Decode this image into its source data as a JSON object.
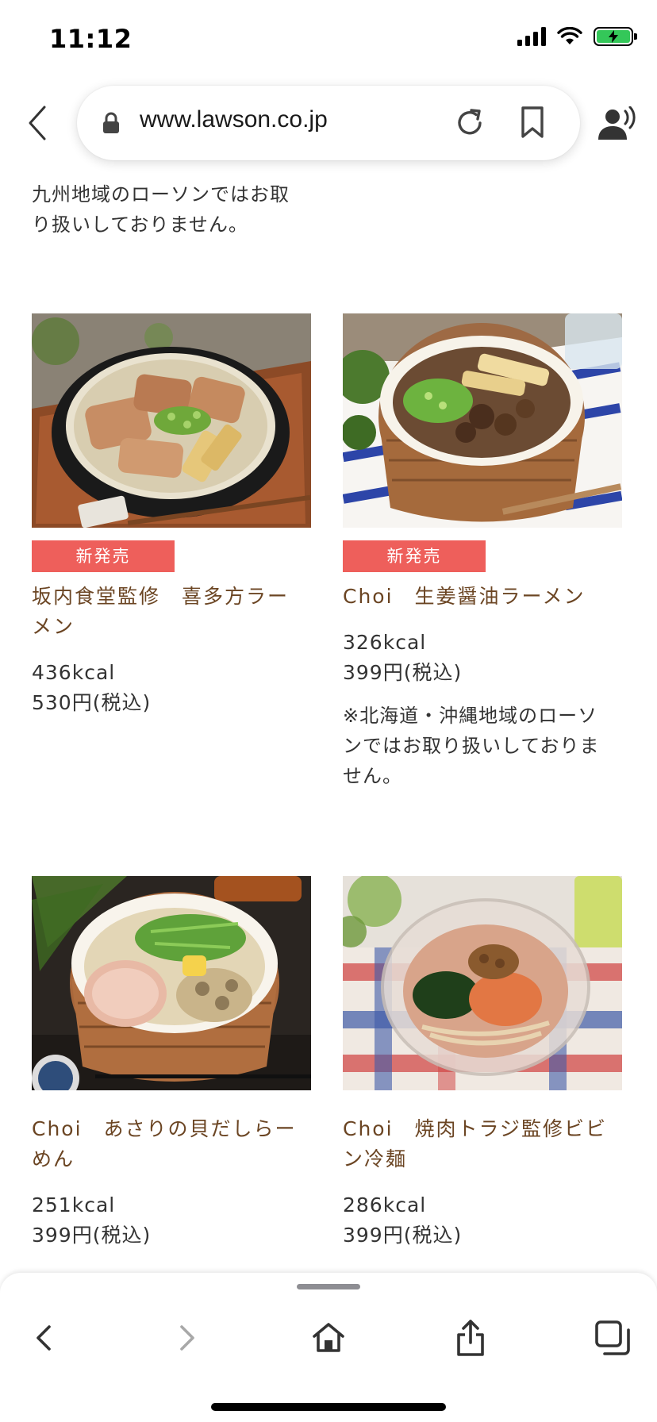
{
  "status_bar": {
    "time": "11:12",
    "icons": [
      "cellular-signal-icon",
      "wifi-icon",
      "battery-charging-icon"
    ],
    "battery_color": "#34c759"
  },
  "browser": {
    "url": "www.lawson.co.jp",
    "icons": [
      "back-arrow-icon",
      "lock-icon",
      "reload-icon",
      "bookmark-icon",
      "listen-icon"
    ]
  },
  "intro_text": "九州地域のローソンではお取り扱いしておりません。",
  "products": [
    {
      "image": "ramen-bowl-chashu-photo",
      "badge": "新発売",
      "name": "坂内食堂監修　喜多方ラーメン",
      "kcal": "436kcal",
      "price": "530円(税込)"
    },
    {
      "image": "ginger-soy-ramen-photo",
      "badge": "新発売",
      "name": "Choi　生姜醤油ラーメン",
      "kcal": "326kcal",
      "price": "399円(税込)",
      "note": "※北海道・沖縄地域のローソンではお取り扱いしておりません。"
    },
    {
      "image": "clam-ramen-photo",
      "name": "Choi　あさりの貝だしらーめん",
      "kcal": "251kcal",
      "price": "399円(税込)"
    },
    {
      "image": "bibim-cold-noodle-photo",
      "name": "Choi　焼肉トラジ監修ビビン冷麺",
      "kcal": "286kcal",
      "price": "399円(税込)"
    }
  ],
  "colors": {
    "badge": "#ee5f5b",
    "product_name": "#6b4523",
    "text": "#333333"
  },
  "toolbar": {
    "icons": [
      "back-icon",
      "forward-icon",
      "home-icon",
      "share-icon",
      "tabs-icon"
    ]
  }
}
